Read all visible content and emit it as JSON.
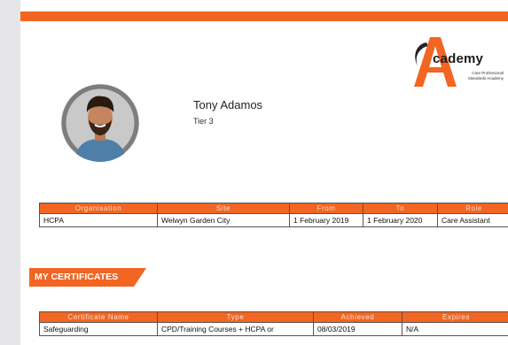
{
  "profile": {
    "name": "Tony Adamos",
    "tier": "Tier 3"
  },
  "logo": {
    "word": "cademy",
    "subtitle_line1": "Care Professional",
    "subtitle_line2": "Standards Academy",
    "brand_color": "#f26522"
  },
  "employment": {
    "headers": [
      "Organisation",
      "Site",
      "From",
      "To",
      "Role"
    ],
    "rows": [
      [
        "HCPA",
        "Welwyn Garden City",
        "1 February 2019",
        "1 February 2020",
        "Care Assistant"
      ]
    ]
  },
  "certificates": {
    "section_title": "MY CERTIFICATES",
    "headers": [
      "Certificate Name",
      "Type",
      "Achieved",
      "Expires"
    ],
    "rows": [
      [
        "Safeguarding",
        "CPD/Training Courses + HCPA or",
        "08/03/2019",
        "N/A"
      ]
    ]
  },
  "colors": {
    "accent": "#f26522",
    "background": "#e6e6e8"
  }
}
